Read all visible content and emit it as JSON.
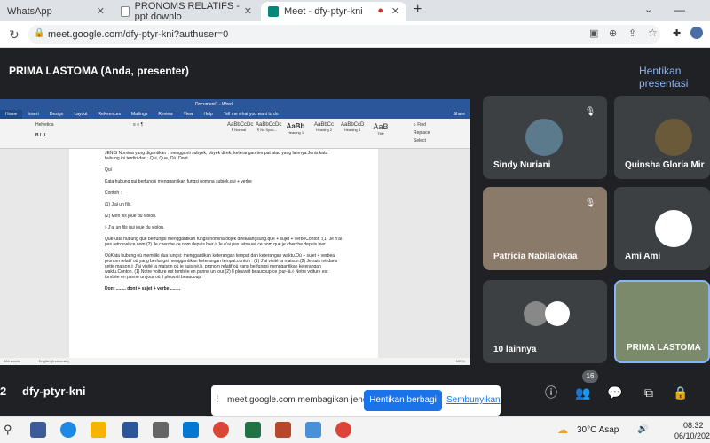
{
  "browser": {
    "tabs": [
      {
        "label": "WhatsApp"
      },
      {
        "label": "PRONOMS RELATIFS - ppt downlo"
      },
      {
        "label": "Meet - dfy-ptyr-kni"
      }
    ],
    "url": "meet.google.com/dfy-ptyr-kni?authuser=0"
  },
  "meet": {
    "presenter_label": "PRIMA LASTOMA (Anda, presenter)",
    "stop_presenting": "Hentikan presentasi",
    "meeting_code": "dfy-ptyr-kni",
    "share_notice": "meet.google.com membagikan jendela.",
    "stop_share_label": "Hentikan berbagi",
    "hide_label": "Sembunyikan",
    "participant_count": "16",
    "participants": [
      {
        "name": "Sindy Nuriani"
      },
      {
        "name": "Quinsha Gloria Mir"
      },
      {
        "name": "Patricia Nabilalokaa"
      },
      {
        "name": "Ami Ami"
      },
      {
        "name": "10 lainnya"
      },
      {
        "name": "PRIMA LASTOMA"
      }
    ]
  },
  "word": {
    "title": "Document1 - Word",
    "tabs": [
      "Home",
      "Insert",
      "Design",
      "Layout",
      "References",
      "Mailings",
      "Review",
      "View",
      "Help",
      "Tell me what you want to do",
      "Share"
    ],
    "styles": [
      "AaBbCcDc",
      "AaBbCcDc",
      "AaBb",
      "AaBbCc",
      "AaBbCcD",
      "AaB"
    ],
    "style_names": [
      "¶ Normal",
      "¶ No Spac...",
      "Heading 1",
      "Heading 2",
      "Heading 3",
      "Title"
    ],
    "lines": [
      "JENIS Nomina yang digantikan : mengganti subyek, obyek direk, keterangan tempat atau yang lainnya.Jenis kata hubung ini terdiri dari : Qui, Que, Où, Dont.",
      "Qui",
      "Kata hubung qui berfungsi menggantikan fungsi nomina subjek.qui + verbe",
      "Contoh :",
      "(1) J'ai un fils.",
      "(2) Mon fils joue du violon.",
      "◊ J'ai un fils qui joue du violon.",
      "QueKata hubung que berfungsi menggantikan fungsi nomina objek direk/langsung.que + sujet + verbeContoh :(1) Je n'ai pas retrouvé ce nom.(2) Je cherche ce nom depuis hier.◊ Je n'ai pas retrouvé ce nom que je cherche depuis hier.",
      "OùKata hubung où memiliki dua fungsi: menggantikan keterangan tempat dan keterangan waktu.Où + sujet + verbea. pronom relatif où yang berfungsi menggantikan keterangan tempat.contoh : (1) J'ai visité la maison.(2) Je suis né dans cette maison.◊ J'ai visité la maison où je suis né.b. pronom relatif où yang berfungsi menggantikan keterangan waktu.Contoh. (1) Notre voiture est tombée en panne un jour.(2) Il pleuvait beaucoup ce jour-là.◊ Notre voiture est tombée en panne un jour où il pleuvait beaucoup.",
      "Dont ........ dont + sujet + verbe ........"
    ],
    "status_words": "434 words",
    "status_lang": "English (Indonesia)",
    "zoom": "100%"
  },
  "taskbar": {
    "weather": "30°C  Asap",
    "time": "08:32",
    "date": "06/10/2021"
  }
}
